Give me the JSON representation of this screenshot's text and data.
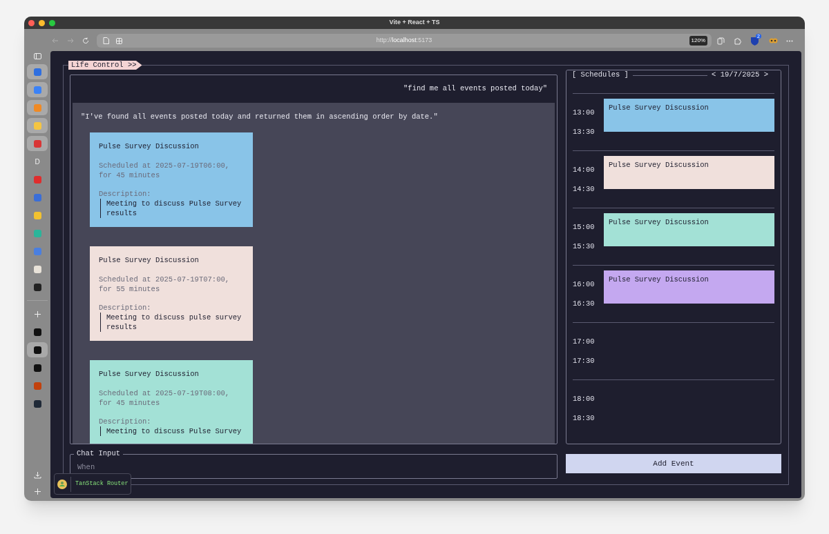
{
  "window": {
    "title": "Vite + React + TS"
  },
  "toolbar": {
    "url_host": "localhost",
    "url_prefix": "http://",
    "url_suffix": ":5173",
    "zoom": "120%",
    "badge": "2"
  },
  "sidebar": {
    "items": [
      {
        "kind": "tile",
        "color": "#2f6fe0",
        "selected": true
      },
      {
        "kind": "tile",
        "color": "#3b82f6",
        "selected": true
      },
      {
        "kind": "tile",
        "color": "#f08a24",
        "selected": true
      },
      {
        "kind": "tile",
        "color": "#f5c542",
        "selected": true
      },
      {
        "kind": "tile",
        "color": "#d93636",
        "selected": true
      },
      {
        "kind": "letter",
        "label": "D",
        "selected": false
      },
      {
        "kind": "tile",
        "color": "#e02d2d",
        "selected": false
      },
      {
        "kind": "tile",
        "color": "#3a6ed8",
        "selected": false
      },
      {
        "kind": "tile",
        "color": "#f2c230",
        "selected": false
      },
      {
        "kind": "tile",
        "color": "#2bb59a",
        "selected": false
      },
      {
        "kind": "tile",
        "color": "#4a7fe0",
        "selected": false
      },
      {
        "kind": "tile",
        "color": "#e8e2d8",
        "selected": false
      },
      {
        "kind": "tile",
        "color": "#222222",
        "selected": false
      },
      {
        "kind": "divider"
      },
      {
        "kind": "plus",
        "selected": false
      },
      {
        "kind": "tile",
        "color": "#111111",
        "selected": false
      },
      {
        "kind": "tile",
        "color": "#111111",
        "selected": true
      },
      {
        "kind": "tile",
        "color": "#111111",
        "selected": false
      },
      {
        "kind": "tile",
        "color": "#c2410c",
        "selected": false
      },
      {
        "kind": "tile",
        "color": "#1f2937",
        "selected": false
      }
    ]
  },
  "app": {
    "title": "Life Control >>",
    "chat": {
      "user_message": "\"find me all events posted today\"",
      "assistant_message": "\"I've found all events posted today and returned them in ascending order by date.\"",
      "events": [
        {
          "title": "Pulse Survey Discussion",
          "scheduled": "Scheduled at 2025-07-19T06:00, for 45 minutes",
          "description_label": "Description:",
          "description": "Meeting to discuss Pulse Survey results",
          "color": "#89c4e8"
        },
        {
          "title": "Pulse Survey Discussion",
          "scheduled": "Scheduled at 2025-07-19T07:00, for 55 minutes",
          "description_label": "Description:",
          "description": "Meeting to discuss pulse survey results",
          "color": "#f0e0dc"
        },
        {
          "title": "Pulse Survey Discussion",
          "scheduled": "Scheduled at 2025-07-19T08:00, for 45 minutes",
          "description_label": "Description:",
          "description": "Meeting to discuss Pulse Survey",
          "color": "#a3e1d6"
        }
      ]
    },
    "schedule": {
      "title": "[ Schedules ]",
      "date": "< 19/7/2025 >",
      "hours": [
        {
          "times": [
            "13:00",
            "13:30"
          ],
          "event": {
            "title": "Pulse Survey Discussion",
            "color": "#89c4e8"
          }
        },
        {
          "times": [
            "14:00",
            "14:30"
          ],
          "event": {
            "title": "Pulse Survey Discussion",
            "color": "#f0e0dc"
          }
        },
        {
          "times": [
            "15:00",
            "15:30"
          ],
          "event": {
            "title": "Pulse Survey Discussion",
            "color": "#a3e1d6"
          }
        },
        {
          "times": [
            "16:00",
            "16:30"
          ],
          "event": {
            "title": "Pulse Survey Discussion",
            "color": "#c4a8f0"
          }
        },
        {
          "times": [
            "17:00",
            "17:30"
          ]
        },
        {
          "times": [
            "18:00",
            "18:30"
          ]
        }
      ]
    },
    "chat_input": {
      "label": "Chat Input",
      "placeholder": "When"
    },
    "add_button": "Add Event"
  },
  "devtools": {
    "label": "TanStack Router"
  }
}
